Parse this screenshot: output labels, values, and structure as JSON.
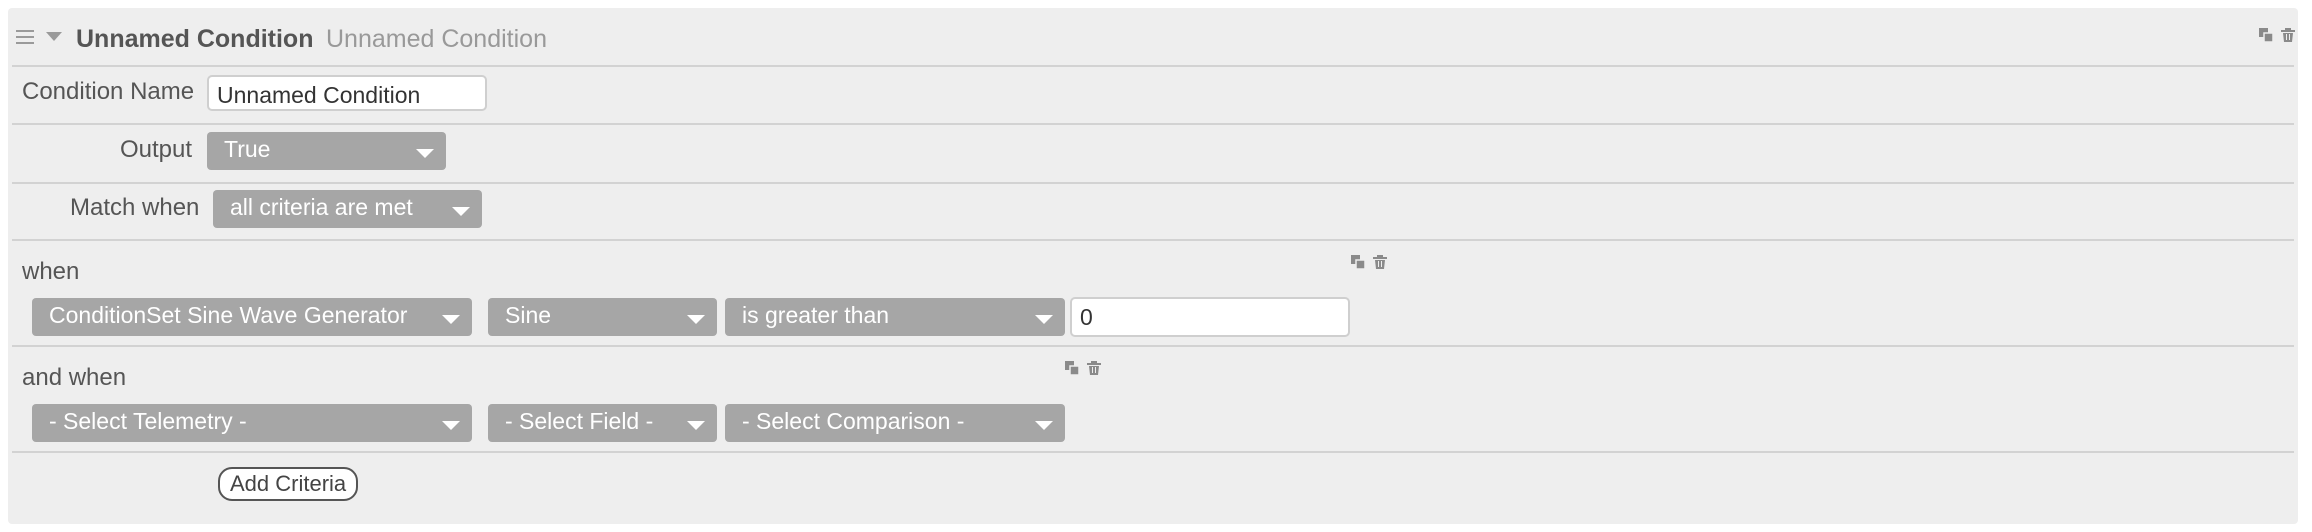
{
  "header": {
    "title": "Unnamed Condition",
    "subtitle": "Unnamed Condition",
    "icons": [
      "duplicate-icon",
      "delete-icon"
    ]
  },
  "condition_name": {
    "label": "Condition Name",
    "value": "Unnamed Condition"
  },
  "output": {
    "label": "Output",
    "selected": "True"
  },
  "match_when": {
    "label": "Match when",
    "selected": "all criteria are met"
  },
  "criteria": [
    {
      "label": "when",
      "telemetry": "ConditionSet Sine Wave Generator",
      "field": "Sine",
      "comparison": "is greater than",
      "value": "0"
    },
    {
      "label": "and when",
      "telemetry": "- Select Telemetry -",
      "field": "- Select Field -",
      "comparison": "- Select Comparison -"
    }
  ],
  "actions": {
    "add_criteria": "Add Criteria"
  },
  "colors": {
    "panel": "#eeeeee",
    "select_bg": "#a6a6a6",
    "separator": "#d2d2d2"
  }
}
